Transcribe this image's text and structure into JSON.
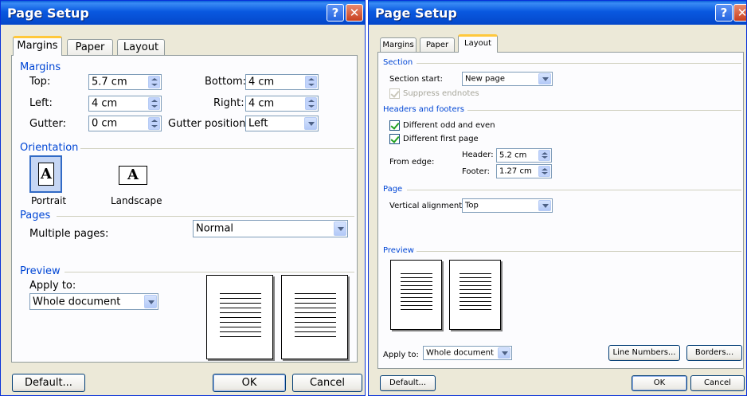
{
  "left_dialog": {
    "title": "Page Setup",
    "help_button": "?",
    "close_button": "✕",
    "tabs": [
      "Margins",
      "Paper",
      "Layout"
    ],
    "margins_group": "Margins",
    "top_label": "Top:",
    "top_value": "5.7 cm",
    "bottom_label": "Bottom:",
    "bottom_value": "4 cm",
    "left_label": "Left:",
    "left_value": "4 cm",
    "right_label": "Right:",
    "right_value": "4 cm",
    "gutter_label": "Gutter:",
    "gutter_value": "0 cm",
    "gutter_position_label": "Gutter position:",
    "gutter_position_value": "Left",
    "orientation_group": "Orientation",
    "portrait_label": "Portrait",
    "landscape_label": "Landscape",
    "orientation_icon_glyph": "A",
    "pages_group": "Pages",
    "multiple_pages_label": "Multiple pages:",
    "multiple_pages_value": "Normal",
    "preview_group": "Preview",
    "apply_to_label": "Apply to:",
    "apply_to_value": "Whole document",
    "default_button": "Default...",
    "ok_button": "OK",
    "cancel_button": "Cancel"
  },
  "right_dialog": {
    "title": "Page Setup",
    "help_button": "?",
    "close_button": "✕",
    "tabs": [
      "Margins",
      "Paper",
      "Layout"
    ],
    "section_group": "Section",
    "section_start_label": "Section start:",
    "section_start_value": "New page",
    "suppress_endnotes_label": "Suppress endnotes",
    "headers_footers_group": "Headers and footers",
    "different_odd_even_label": "Different odd and even",
    "different_first_page_label": "Different first page",
    "from_edge_label": "From edge:",
    "header_label": "Header:",
    "header_value": "5.2 cm",
    "footer_label": "Footer:",
    "footer_value": "1.27 cm",
    "page_group": "Page",
    "vertical_alignment_label": "Vertical alignment:",
    "vertical_alignment_value": "Top",
    "preview_group": "Preview",
    "apply_to_label": "Apply to:",
    "apply_to_value": "Whole document",
    "line_numbers_button": "Line Numbers...",
    "borders_button": "Borders...",
    "default_button": "Default...",
    "ok_button": "OK",
    "cancel_button": "Cancel"
  },
  "colors": {
    "title_bar": "#0958e0",
    "group_heading": "#0046d5",
    "dialog_face": "#ece9d8",
    "active_tab_accent": "#ffc83c"
  }
}
